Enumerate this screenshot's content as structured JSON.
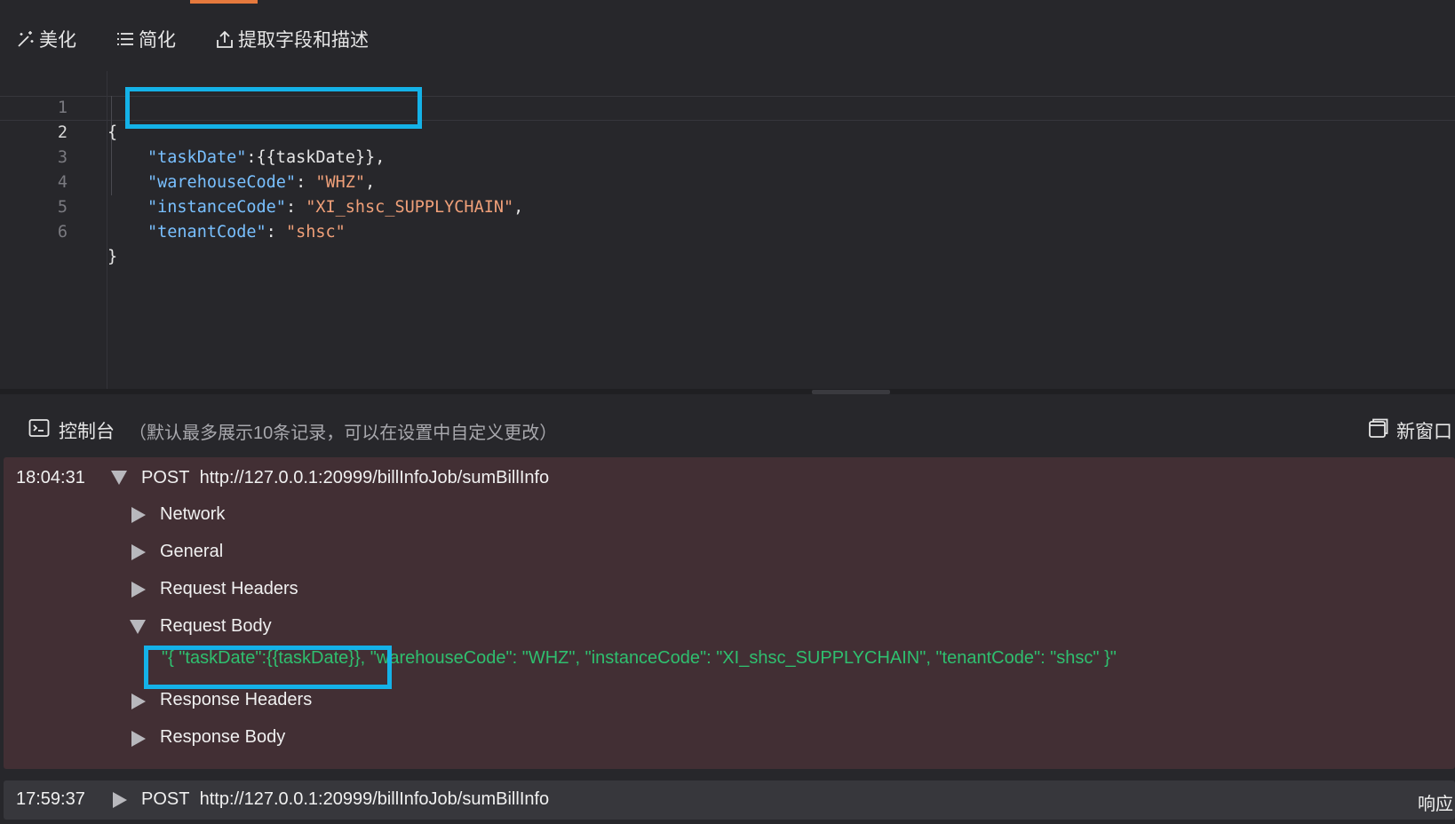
{
  "toolbar": {
    "beautify_label": "美化",
    "simplify_label": "简化",
    "extract_label": "提取字段和描述"
  },
  "editor": {
    "line_numbers": [
      "1",
      "2",
      "3",
      "4",
      "5",
      "6"
    ],
    "lines": [
      {
        "open": "{"
      },
      {
        "key": "\"taskDate\"",
        "sep": ":",
        "value": "{{taskDate}}",
        "end": ","
      },
      {
        "key": "\"warehouseCode\"",
        "sep": ": ",
        "value": "\"WHZ\"",
        "end": ","
      },
      {
        "key": "\"instanceCode\"",
        "sep": ": ",
        "value": "\"XI_shsc_SUPPLYCHAIN\"",
        "end": ","
      },
      {
        "key": "\"tenantCode\"",
        "sep": ": ",
        "value": "\"shsc\"",
        "end": ""
      },
      {
        "open": "}"
      }
    ]
  },
  "console": {
    "title": "控制台",
    "note": "（默认最多展示10条记录，可以在设置中自定义更改）",
    "new_window_label": "新窗口",
    "logs": [
      {
        "time": "18:04:31",
        "method": "POST",
        "url": "http://127.0.0.1:20999/billInfoJob/sumBillInfo",
        "sections": [
          "Network",
          "General",
          "Request Headers",
          "Request Body",
          "Response Headers",
          "Response Body"
        ],
        "request_body": "\"{ \"taskDate\":{{taskDate}}, \"warehouseCode\": \"WHZ\", \"instanceCode\": \"XI_shsc_SUPPLYCHAIN\", \"tenantCode\": \"shsc\" }\""
      },
      {
        "time": "17:59:37",
        "method": "POST",
        "url": "http://127.0.0.1:20999/billInfoJob/sumBillInfo",
        "response_label": "响应"
      }
    ]
  },
  "colors": {
    "accent_tab": "#e5793d",
    "highlight_box": "#14b2e8",
    "json_key": "#79c0ff",
    "json_string": "#f0a079",
    "body_green": "#2fbf6f",
    "error_log_bg": "#422f34"
  }
}
